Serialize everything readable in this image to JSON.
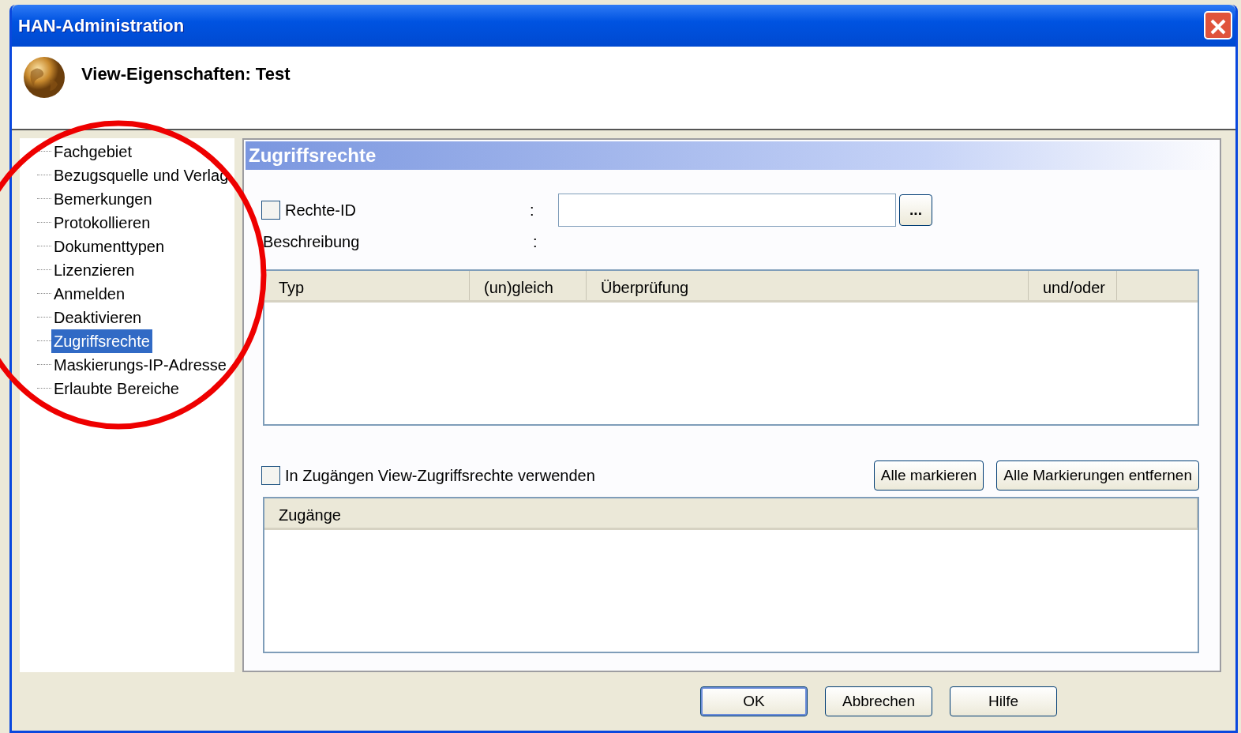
{
  "window": {
    "title": "HAN-Administration"
  },
  "header": {
    "title": "View-Eigenschaften: Test"
  },
  "tree": {
    "items": [
      {
        "label": "Fachgebiet",
        "selected": false
      },
      {
        "label": "Bezugsquelle und Verlag",
        "selected": false
      },
      {
        "label": "Bemerkungen",
        "selected": false
      },
      {
        "label": "Protokollieren",
        "selected": false
      },
      {
        "label": "Dokumenttypen",
        "selected": false
      },
      {
        "label": "Lizenzieren",
        "selected": false
      },
      {
        "label": "Anmelden",
        "selected": false
      },
      {
        "label": "Deaktivieren",
        "selected": false
      },
      {
        "label": "Zugriffsrechte",
        "selected": true
      },
      {
        "label": "Maskierungs-IP-Adresse",
        "selected": false
      },
      {
        "label": "Erlaubte Bereiche",
        "selected": false
      }
    ]
  },
  "panel": {
    "title": "Zugriffsrechte",
    "rights_id": {
      "label": "Rechte-ID",
      "checked": false,
      "separator": ":",
      "browse_button": "..."
    },
    "description": {
      "label": "Beschreibung",
      "separator": ":"
    },
    "rules_table": {
      "columns": [
        "Typ",
        "(un)gleich",
        "Überprüfung",
        "und/oder"
      ]
    },
    "use_view_rights": {
      "label": "In Zugängen View-Zugriffsrechte verwenden",
      "checked": false
    },
    "buttons": [
      "Alle markieren",
      "Alle Markierungen entfernen"
    ],
    "access_table": {
      "columns": [
        "Zugänge"
      ]
    }
  },
  "buttons": [
    {
      "label": "OK",
      "default": true
    },
    {
      "label": "Abbrechen",
      "default": false
    },
    {
      "label": "Hilfe",
      "default": false
    }
  ]
}
